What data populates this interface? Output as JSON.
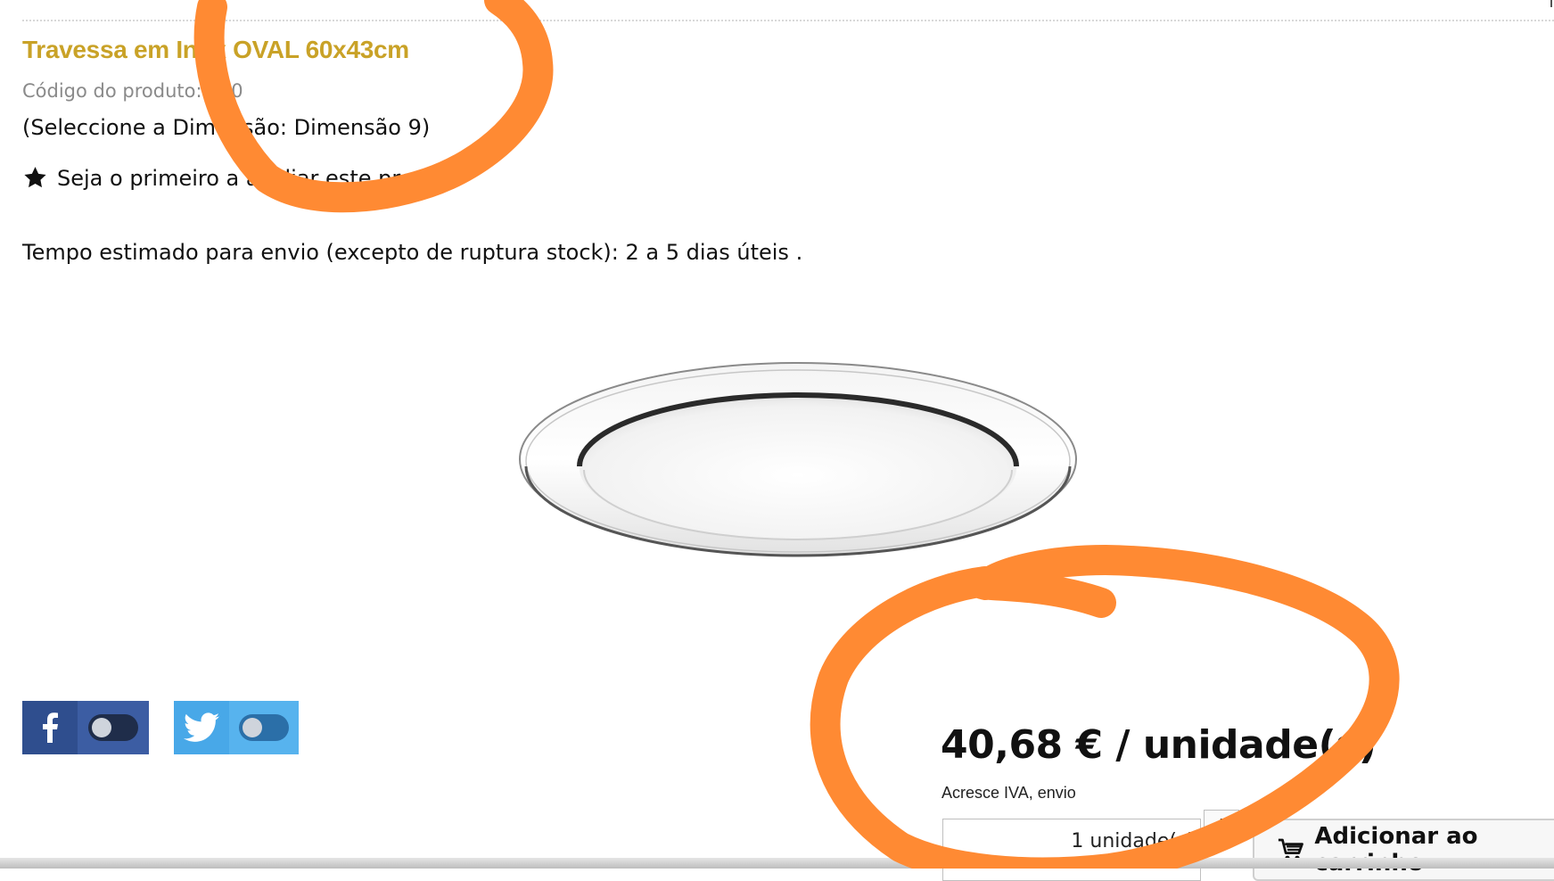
{
  "product": {
    "title": "Travessa em Inox OVAL 60x43cm",
    "code_label": "Código do produto:",
    "code_value": "160",
    "selection_text": "(Seleccione a Dimensão: Dimensão 9)",
    "rating_text": "Seja o primeiro a avaliar este produto",
    "shipping_text": "Tempo estimado para envio (excepto de ruptura stock): 2 a 5 dias úteis ."
  },
  "purchase": {
    "price": "40,68 € / unidade(s)",
    "tax_note": "Acresce IVA, envio",
    "quantity_value": "1 unidade(s)",
    "plus_label": "+",
    "add_to_cart_label": "Adicionar ao carrinho"
  },
  "social": {
    "facebook_icon": "facebook-icon",
    "twitter_icon": "twitter-icon",
    "facebook_share_enabled": false,
    "twitter_share_enabled": false
  },
  "colors": {
    "title": "#c9a227",
    "annotation": "#ff8a33",
    "facebook": "#3c5da3",
    "twitter": "#57b3ee"
  }
}
